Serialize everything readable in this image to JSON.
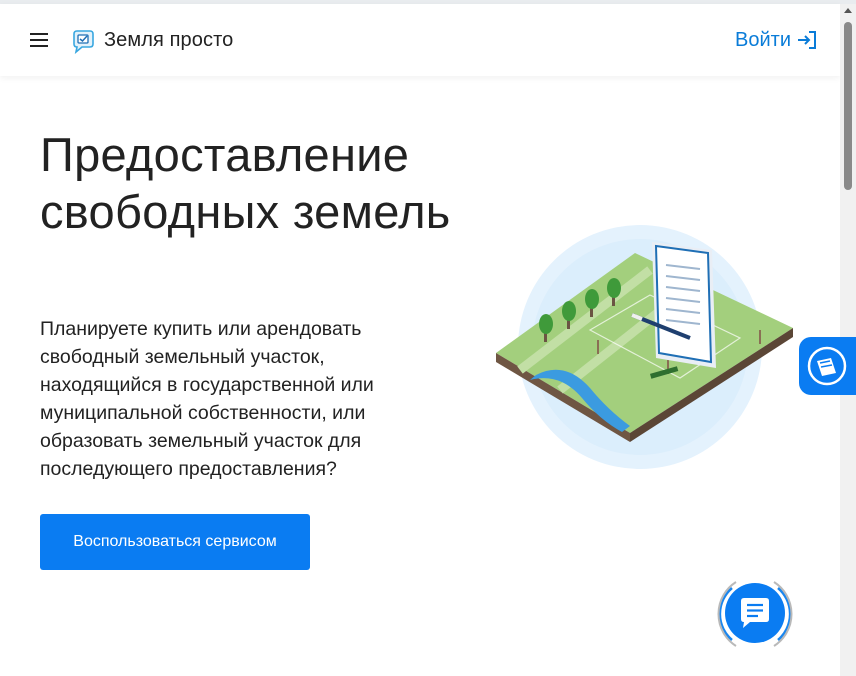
{
  "header": {
    "logo_text": "Земля просто",
    "login_label": "Войти"
  },
  "hero": {
    "title": "Предоставление свободных земель",
    "description": "Планируете купить или арендовать свободный земельный участок, находящийся в государственной или муниципальной собственности, или образовать земельный участок для последующего предоставления?",
    "cta_label": "Воспользоваться сервисом"
  },
  "colors": {
    "accent": "#0a7cf2",
    "link": "#0a7cd8",
    "text": "#222222"
  },
  "icons": {
    "menu": "menu-icon",
    "logo": "logo-icon",
    "login": "login-icon",
    "side_tab": "document-icon",
    "chat": "chat-icon"
  }
}
